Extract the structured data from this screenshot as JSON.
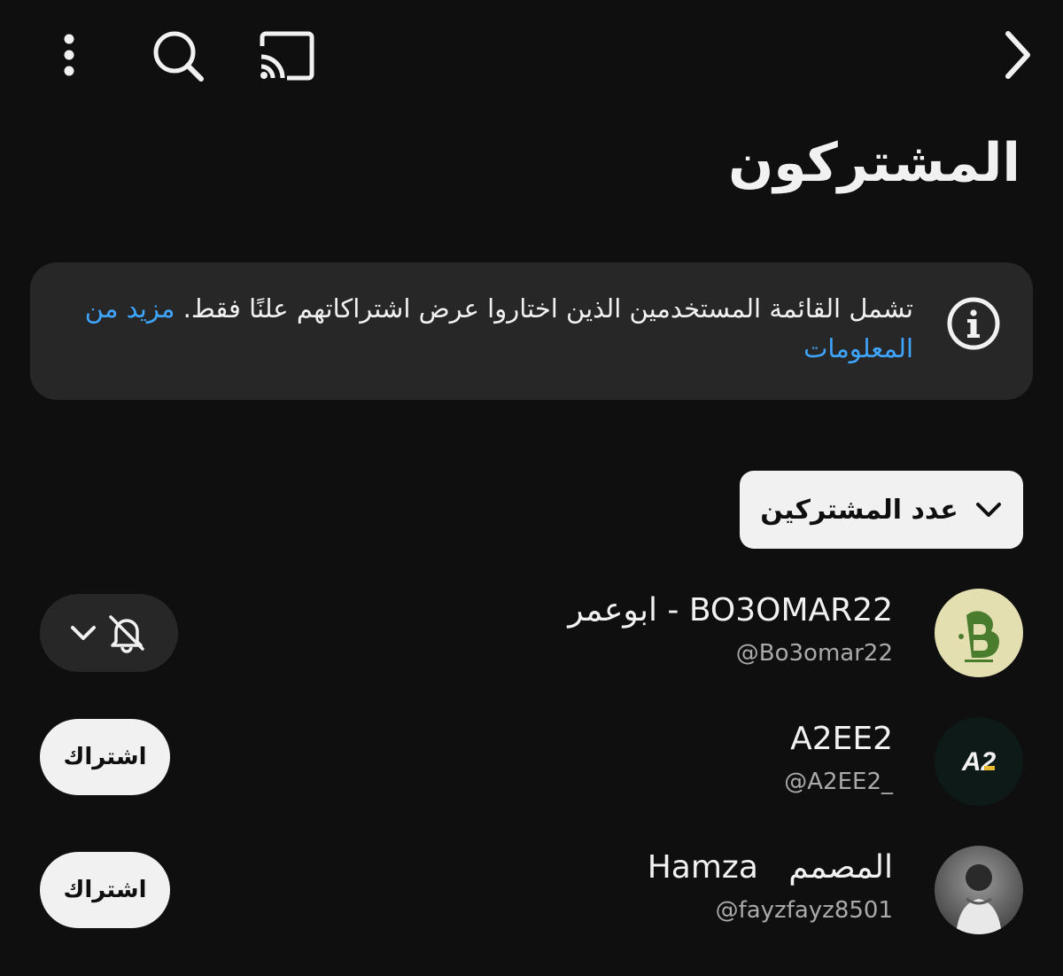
{
  "header": {
    "title": "المشتركون",
    "icons": [
      "more-vert-icon",
      "search-icon",
      "cast-icon",
      "chevron-right-icon"
    ]
  },
  "info": {
    "text": "تشمل القائمة المستخدمين الذين اختاروا عرض اشتراكاتهم علنًا فقط.",
    "link": "مزيد من المعلومات"
  },
  "sort": {
    "label": "عدد المشتركين"
  },
  "subscribers": [
    {
      "name": "ابوعمر - BO3OMAR22",
      "handle": "@Bo3omar22",
      "subscribed": true
    },
    {
      "name": "A2EE2",
      "handle": "@A2EE2_",
      "subscribed": false,
      "button": "اشتراك",
      "avatar_text": "A2"
    },
    {
      "name": "المصمم   Hamza",
      "handle": "@fayzfayz8501",
      "subscribed": false,
      "button": "اشتراك"
    }
  ],
  "colors": {
    "background": "#0f0f0f",
    "card": "#272727",
    "link": "#3ea6ff",
    "chip": "#f1f1f1"
  }
}
